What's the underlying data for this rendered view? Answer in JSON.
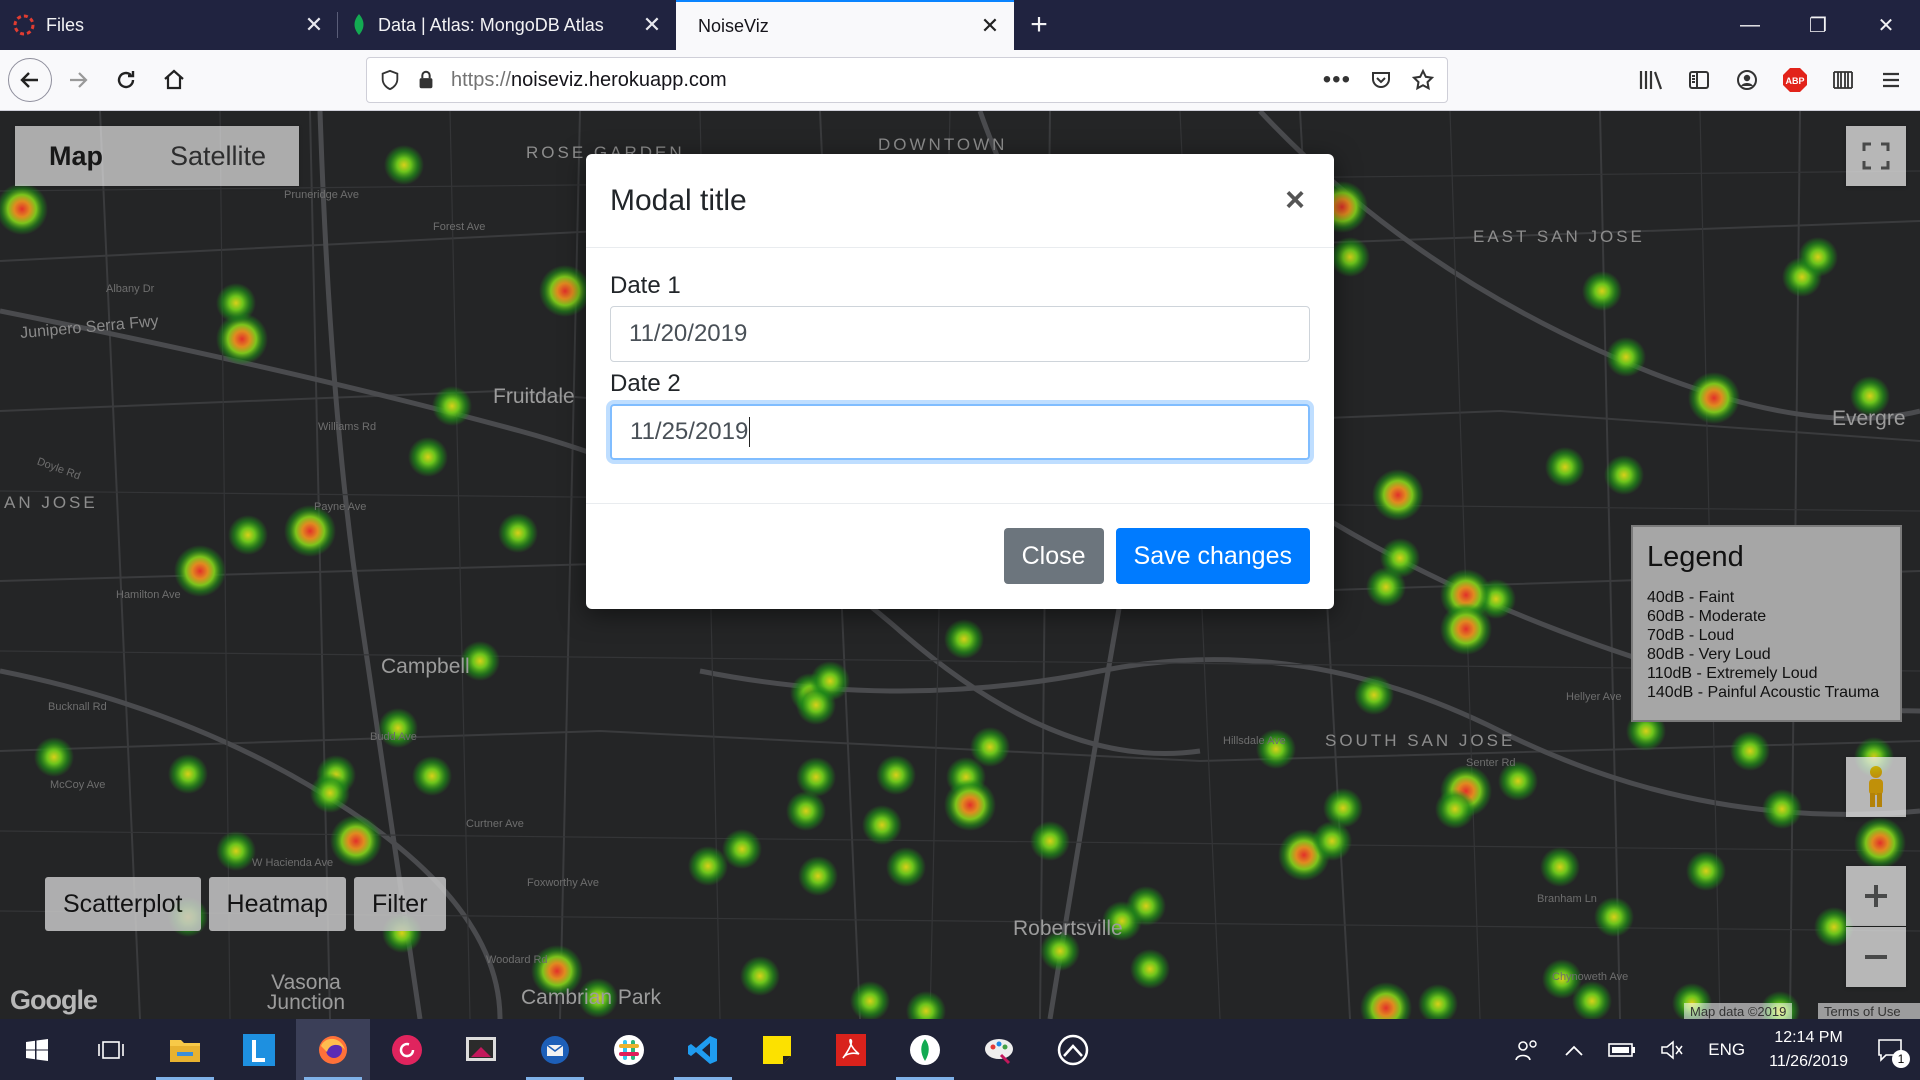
{
  "browser": {
    "tabs": [
      {
        "title": "Files",
        "active": false
      },
      {
        "title": "Data | Atlas: MongoDB Atlas",
        "active": false
      },
      {
        "title": "NoiseViz",
        "active": true
      }
    ],
    "url_scheme": "https://",
    "url_host": "noiseviz.herokuapp.com"
  },
  "map": {
    "type_map": "Map",
    "type_satellite": "Satellite",
    "labels": {
      "rose_garden": "ROSE GARDEN",
      "downtown": "DOWNTOWN",
      "east_san_jose": "EAST SAN JOSE",
      "san_jose_west": "AN JOSE",
      "south_san_jose": "SOUTH SAN JOSE",
      "fruitdale": "Fruitdale",
      "campbell": "Campbell",
      "evergreen": "Evergre",
      "robertsville": "Robertsville",
      "vasona_junction": "Vasona Junction",
      "cambrian_park": "Cambrian Park",
      "junipero": "Junipero Serra Fwy",
      "albany": "Albany Dr",
      "forest": "Forest Ave",
      "pruneridge": "Pruneridge Ave",
      "williams": "Williams Rd",
      "payne": "Payne Ave",
      "hamilton": "Hamilton Ave",
      "bucknall": "Bucknall Rd",
      "budd": "Budd Ave",
      "mccoy": "McCoy Ave",
      "curtner": "Curtner Ave",
      "foxworthy": "Foxworthy Ave",
      "hacienda": "W Hacienda Ave",
      "hillsdale": "Hillsdale Ave",
      "branham": "Branham Ln",
      "senter": "Senter Rd",
      "hellyer": "Hellyer Ave",
      "woodard": "Woodard Rd",
      "chynoweth": "Chynoweth Ave",
      "doyle": "Doyle Rd"
    },
    "legend": {
      "title": "Legend",
      "items": [
        "40dB - Faint",
        "60dB - Moderate",
        "70dB - Loud",
        "80dB - Very Loud",
        "110dB - Extremely Loud",
        "140dB - Painful Acoustic Trauma"
      ]
    },
    "buttons": {
      "scatterplot": "Scatterplot",
      "heatmap": "Heatmap",
      "filter": "Filter"
    },
    "google": "Google",
    "map_data": "Map data ©2019",
    "terms": "Terms of Use"
  },
  "modal": {
    "title": "Modal title",
    "close_x": "×",
    "date1_label": "Date 1",
    "date1_value": "11/20/2019",
    "date2_label": "Date 2",
    "date2_value": "11/25/2019",
    "close_button": "Close",
    "save_button": "Save changes"
  },
  "taskbar": {
    "language": "ENG",
    "time": "12:14 PM",
    "date": "11/26/2019",
    "notification_count": "1"
  },
  "colors": {
    "primary": "#007bff",
    "secondary": "#6c757d",
    "heat_low": "#2fa81c",
    "heat_mid": "#c8c81a",
    "heat_high": "#e0302a"
  }
}
